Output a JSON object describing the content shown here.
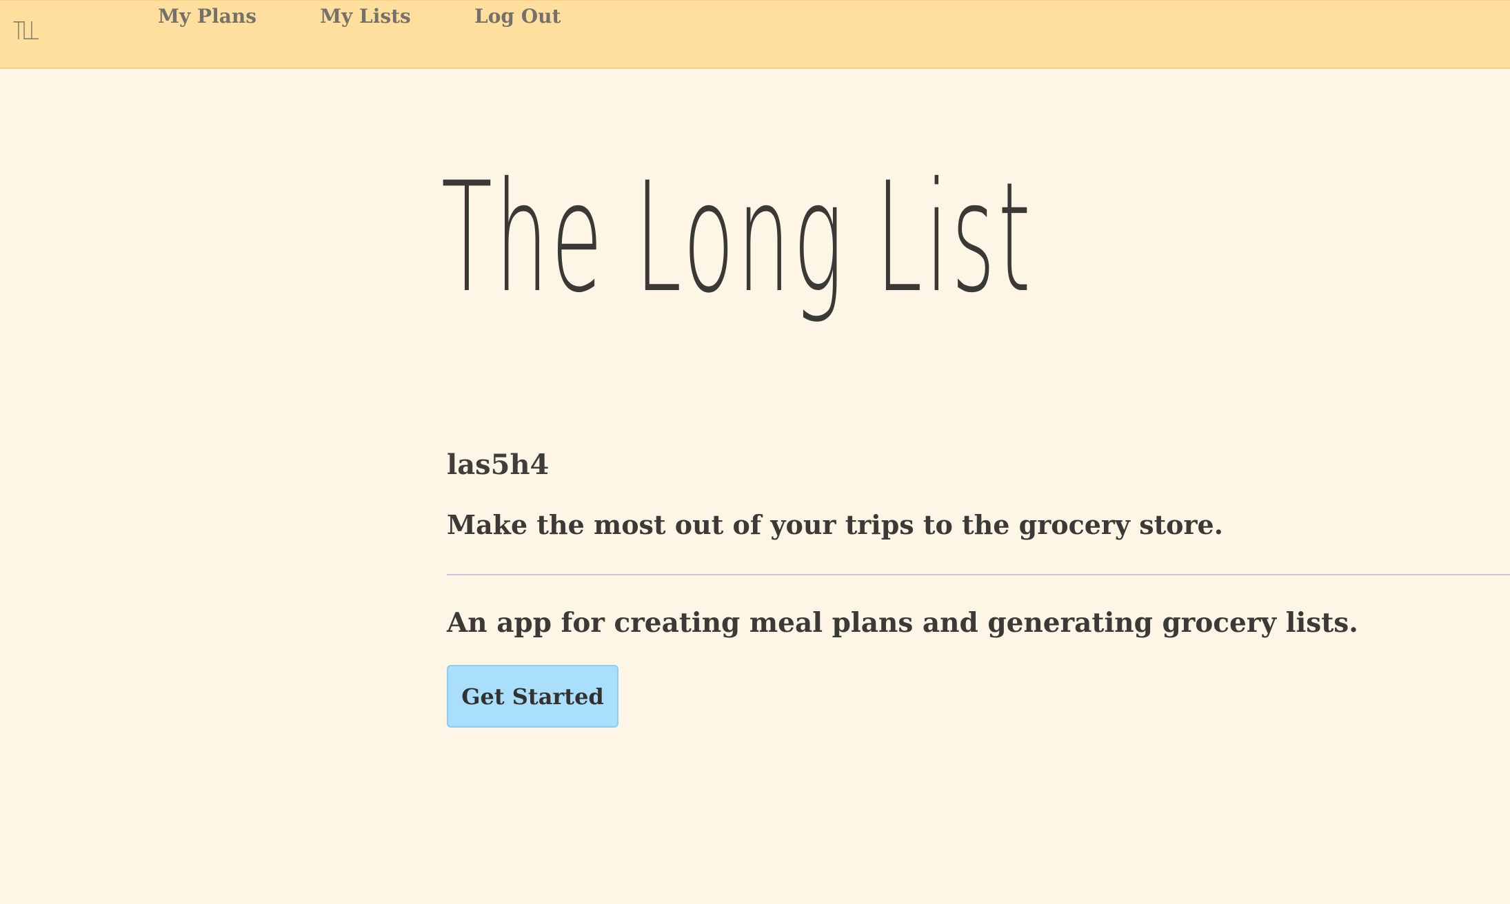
{
  "nav": {
    "brand": "TLL",
    "links": [
      {
        "label": "My Plans"
      },
      {
        "label": "My Lists"
      },
      {
        "label": "Log Out"
      }
    ]
  },
  "hero": {
    "title": "The Long List",
    "username": "las5h4",
    "tagline": "Make the most out of your trips to the grocery store.",
    "description": "An app for creating meal plans and generating grocery lists.",
    "cta_label": "Get Started"
  },
  "colors": {
    "navbar": "#ffdf9d",
    "background": "#fdf5e6",
    "button": "#aadffb",
    "text": "#3b3a38"
  }
}
